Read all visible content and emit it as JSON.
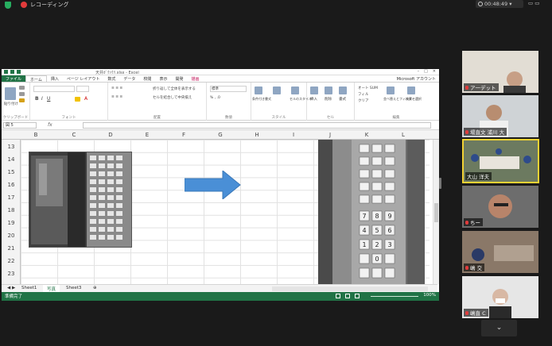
{
  "top": {
    "recording_label": "レコーディング",
    "timer": "00:48:49"
  },
  "excel": {
    "title": "天井ｶﾞｸｯｸﾘ.xlsx - Excel",
    "tabs": [
      "ファイル",
      "ホーム",
      "挿入",
      "ページ レイアウト",
      "数式",
      "データ",
      "校閲",
      "表示",
      "開発",
      "描画"
    ],
    "account": "Microsoft アカウント",
    "ribbon_groups": [
      "クリップボード",
      "フォント",
      "配置",
      "数値",
      "スタイル",
      "セル",
      "編集"
    ],
    "ribbon_labels": {
      "paste": "貼り付け",
      "wrap": "折り返して全体を表示する",
      "merge": "セルを結合して中央揃え",
      "number_format": "標準",
      "conditional": "条件付き書式",
      "table": "テーブルとして書式設定",
      "cell_styles": "セルのスタイル",
      "insert": "挿入",
      "delete": "削除",
      "format": "書式",
      "autosum": "オート SUM",
      "fill": "フィル",
      "clear": "クリア",
      "sort": "並べ替えとフィルター",
      "find": "検索と選択"
    },
    "name_box": "図 5",
    "fx": "fx",
    "columns": [
      "B",
      "C",
      "D",
      "E",
      "F",
      "G",
      "H",
      "I",
      "J",
      "K",
      "L"
    ],
    "rows": [
      "13",
      "14",
      "15",
      "16",
      "17",
      "18",
      "19",
      "20",
      "21",
      "22",
      "23"
    ],
    "sheets": [
      "Sheet1",
      "写真",
      "Sheet3"
    ],
    "status_ready": "準備完了",
    "zoom": "100%",
    "keypad_keys": [
      "7",
      "8",
      "9",
      "4",
      "5",
      "6",
      "1",
      "2",
      "3",
      "0"
    ]
  },
  "participants": [
    {
      "name": "ア一デット"
    },
    {
      "name": "場直文 浦川 大"
    },
    {
      "name": "大山 洋夫"
    },
    {
      "name": "ちー"
    },
    {
      "name": "嶋 交"
    },
    {
      "name": "嶋直 C"
    }
  ],
  "colors": {
    "excel_green": "#217346",
    "arrow_blue": "#4a8fd6",
    "active_border": "#f2d234"
  }
}
